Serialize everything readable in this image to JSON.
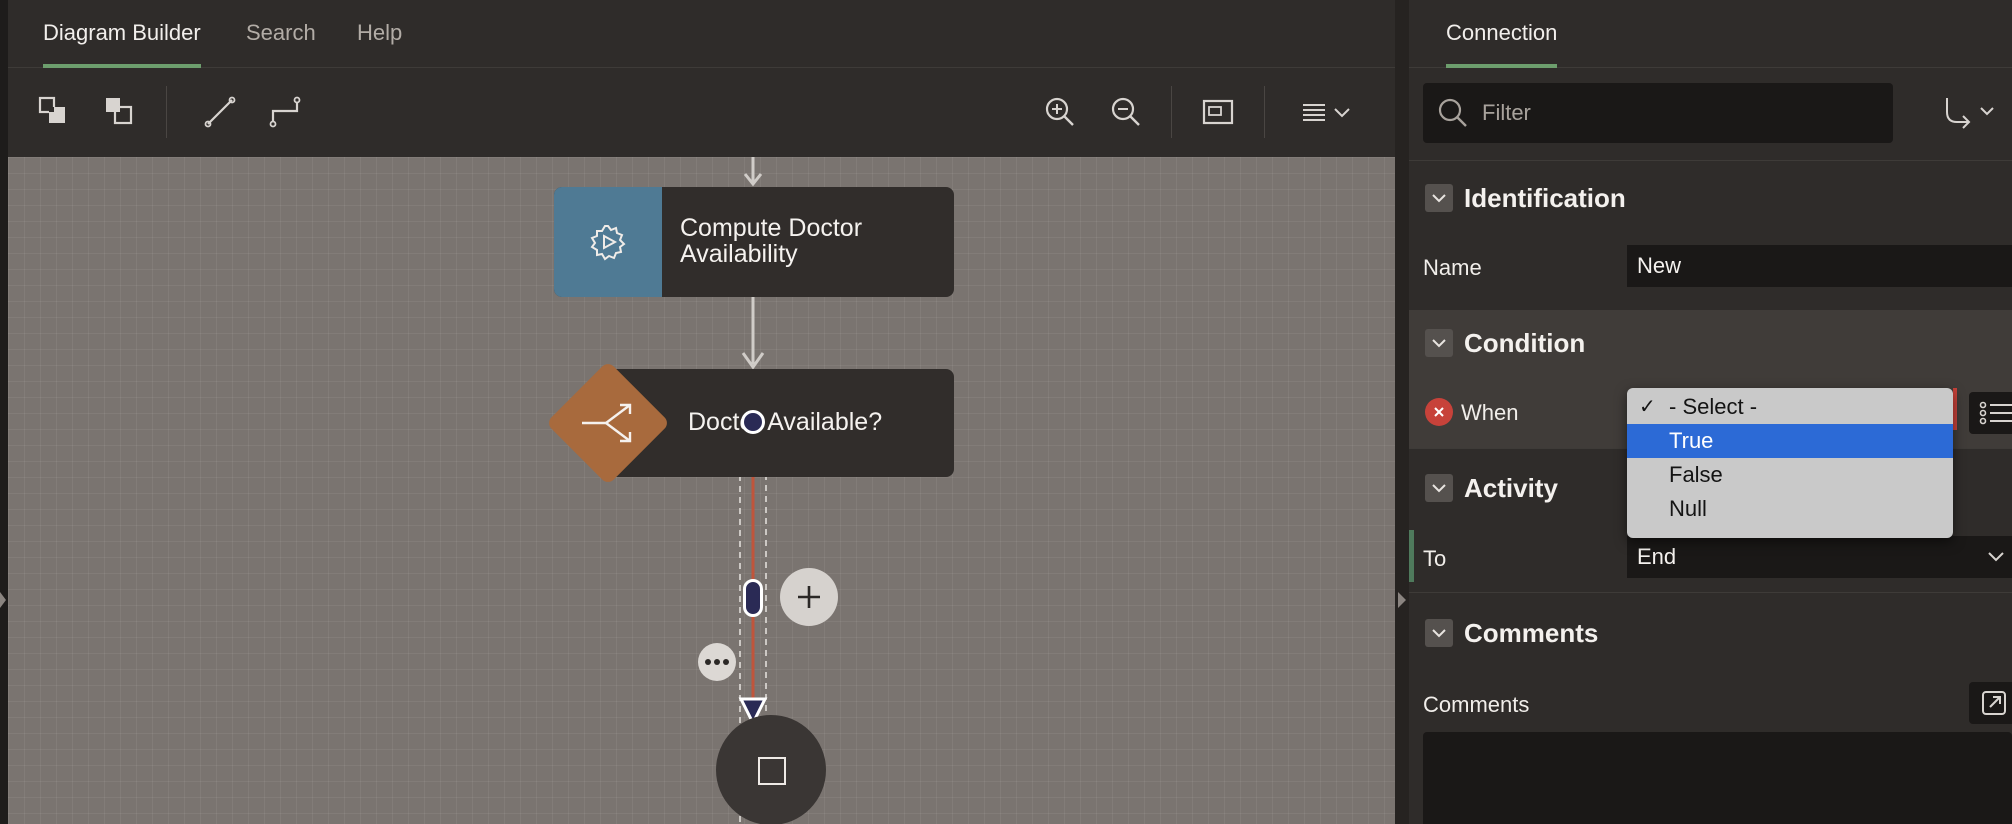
{
  "left_tabs": [
    {
      "label": "Diagram Builder",
      "active": true
    },
    {
      "label": "Search",
      "active": false
    },
    {
      "label": "Help",
      "active": false
    }
  ],
  "toolbar": {
    "icons": [
      "bring-to-front-icon",
      "send-to-back-icon",
      "straight-line-icon",
      "elbow-line-icon",
      "zoom-in-icon",
      "zoom-out-icon",
      "fit-screen-icon",
      "menu-icon"
    ]
  },
  "diagram": {
    "node1": {
      "label": "Compute Doctor Availability",
      "icon": "gear-play-icon",
      "color": "#4f7a94"
    },
    "node2": {
      "label": "Doctor Available?",
      "icon": "split-arrow-icon",
      "color": "#a86a3d"
    },
    "end": {
      "icon": "stop-square-icon"
    },
    "edge_color": "#c0553b"
  },
  "right_panel": {
    "tab": "Connection",
    "filter_placeholder": "Filter",
    "sections": {
      "identification": {
        "title": "Identification",
        "name_label": "Name",
        "name_value": "New"
      },
      "condition": {
        "title": "Condition",
        "when_label": "When"
      },
      "activity": {
        "title": "Activity",
        "to_label": "To",
        "to_value": "End"
      },
      "comments": {
        "title": "Comments",
        "comments_label": "Comments"
      }
    },
    "dropdown": {
      "options": [
        {
          "label": "- Select -",
          "checked": true,
          "highlighted": false
        },
        {
          "label": "True",
          "checked": false,
          "highlighted": true
        },
        {
          "label": "False",
          "checked": false,
          "highlighted": false
        },
        {
          "label": "Null",
          "checked": false,
          "highlighted": false
        }
      ],
      "highlight_color": "#2c6ad6"
    }
  }
}
